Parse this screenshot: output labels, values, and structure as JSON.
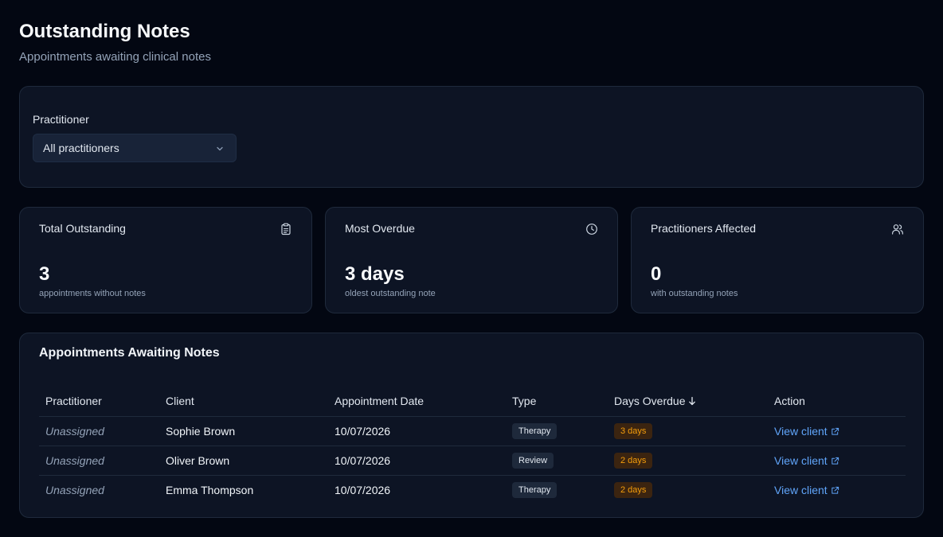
{
  "header": {
    "title": "Outstanding Notes",
    "subtitle": "Appointments awaiting clinical notes"
  },
  "filter": {
    "label": "Practitioner",
    "selected": "All practitioners"
  },
  "stats": [
    {
      "label": "Total Outstanding",
      "value": "3",
      "desc": "appointments without notes",
      "icon": "clipboard-icon"
    },
    {
      "label": "Most Overdue",
      "value": "3 days",
      "desc": "oldest outstanding note",
      "icon": "clock-icon"
    },
    {
      "label": "Practitioners Affected",
      "value": "0",
      "desc": "with outstanding notes",
      "icon": "users-icon"
    }
  ],
  "table": {
    "title": "Appointments Awaiting Notes",
    "headers": {
      "practitioner": "Practitioner",
      "client": "Client",
      "date": "Appointment Date",
      "type": "Type",
      "days": "Days Overdue",
      "action": "Action"
    },
    "rows": [
      {
        "practitioner": "Unassigned",
        "client": "Sophie Brown",
        "date": "10/07/2026",
        "type": "Therapy",
        "days": "3 days",
        "action": "View client"
      },
      {
        "practitioner": "Unassigned",
        "client": "Oliver Brown",
        "date": "10/07/2026",
        "type": "Review",
        "days": "2 days",
        "action": "View client"
      },
      {
        "practitioner": "Unassigned",
        "client": "Emma Thompson",
        "date": "10/07/2026",
        "type": "Therapy",
        "days": "2 days",
        "action": "View client"
      }
    ]
  },
  "colors": {
    "background": "#030712",
    "card": "#0d1424",
    "link": "#60a5fa",
    "overdue": "#f59e0b"
  }
}
